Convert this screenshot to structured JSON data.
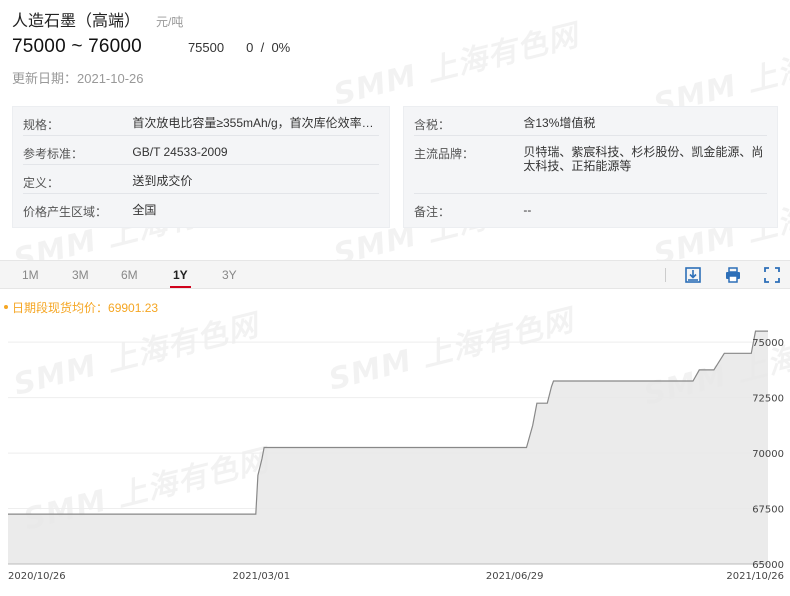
{
  "product": {
    "title": "人造石墨（高端）",
    "unit": "元/吨",
    "price_low": "75000",
    "price_high": "76000",
    "price_sep": "~",
    "average": "75500",
    "change": "0",
    "change_sep": "/",
    "change_pct": "0%",
    "updated_label": "更新日期：",
    "updated_date": "2021-10-26"
  },
  "specs_left": [
    {
      "label": "规格：",
      "value": "首次放电比容量≥355mAh/g，首次库伦效率…"
    },
    {
      "label": "参考标准：",
      "value": "GB/T 24533-2009"
    },
    {
      "label": "定义：",
      "value": "送到成交价"
    },
    {
      "label": "价格产生区域：",
      "value": "全国"
    }
  ],
  "specs_right": [
    {
      "label": "含税：",
      "value": "含13%增值税"
    },
    {
      "label": "主流品牌：",
      "value": "贝特瑞、紫宸科技、杉杉股份、凯金能源、尚太科技、正拓能源等"
    },
    {
      "label": "备注：",
      "value": "--"
    }
  ],
  "tabs": [
    {
      "label": "1M",
      "active": false
    },
    {
      "label": "3M",
      "active": false
    },
    {
      "label": "6M",
      "active": false
    },
    {
      "label": "1Y",
      "active": true
    },
    {
      "label": "3Y",
      "active": false
    }
  ],
  "toolbar_icons": [
    "download-image-icon",
    "print-icon",
    "fullscreen-icon"
  ],
  "watermark": {
    "brand": "SMM",
    "text": "上海有色网"
  },
  "colors": {
    "active_tab_underline": "#d0021b",
    "legend": "#f5a623",
    "series_line": "#888888",
    "area_fill": "#e8e8e8"
  },
  "chart_data": {
    "type": "area",
    "legend_label": "日期段现货均价：",
    "legend_value": "69901.23",
    "ylim": [
      65000,
      76000
    ],
    "yticks": [
      65000,
      67500,
      70000,
      72500,
      75000
    ],
    "xtick_labels": [
      "2020/10/26",
      "2021/03/01",
      "2021/06/29",
      "2021/10/26"
    ],
    "xlim": [
      "2020-10-26",
      "2021-10-26"
    ],
    "series": [
      {
        "points": [
          [
            "2020-10-26",
            67250
          ],
          [
            "2021-02-22",
            67250
          ],
          [
            "2021-02-23",
            69000
          ],
          [
            "2021-02-25",
            69750
          ],
          [
            "2021-02-26",
            70250
          ],
          [
            "2021-07-02",
            70250
          ],
          [
            "2021-07-05",
            71250
          ],
          [
            "2021-07-07",
            72250
          ],
          [
            "2021-07-09",
            72250
          ],
          [
            "2021-07-12",
            72250
          ],
          [
            "2021-07-14",
            73000
          ],
          [
            "2021-07-15",
            73250
          ],
          [
            "2021-09-20",
            73250
          ],
          [
            "2021-09-23",
            73750
          ],
          [
            "2021-09-30",
            73750
          ],
          [
            "2021-10-05",
            74500
          ],
          [
            "2021-10-18",
            74500
          ],
          [
            "2021-10-20",
            75500
          ],
          [
            "2021-10-26",
            75500
          ]
        ]
      }
    ]
  }
}
